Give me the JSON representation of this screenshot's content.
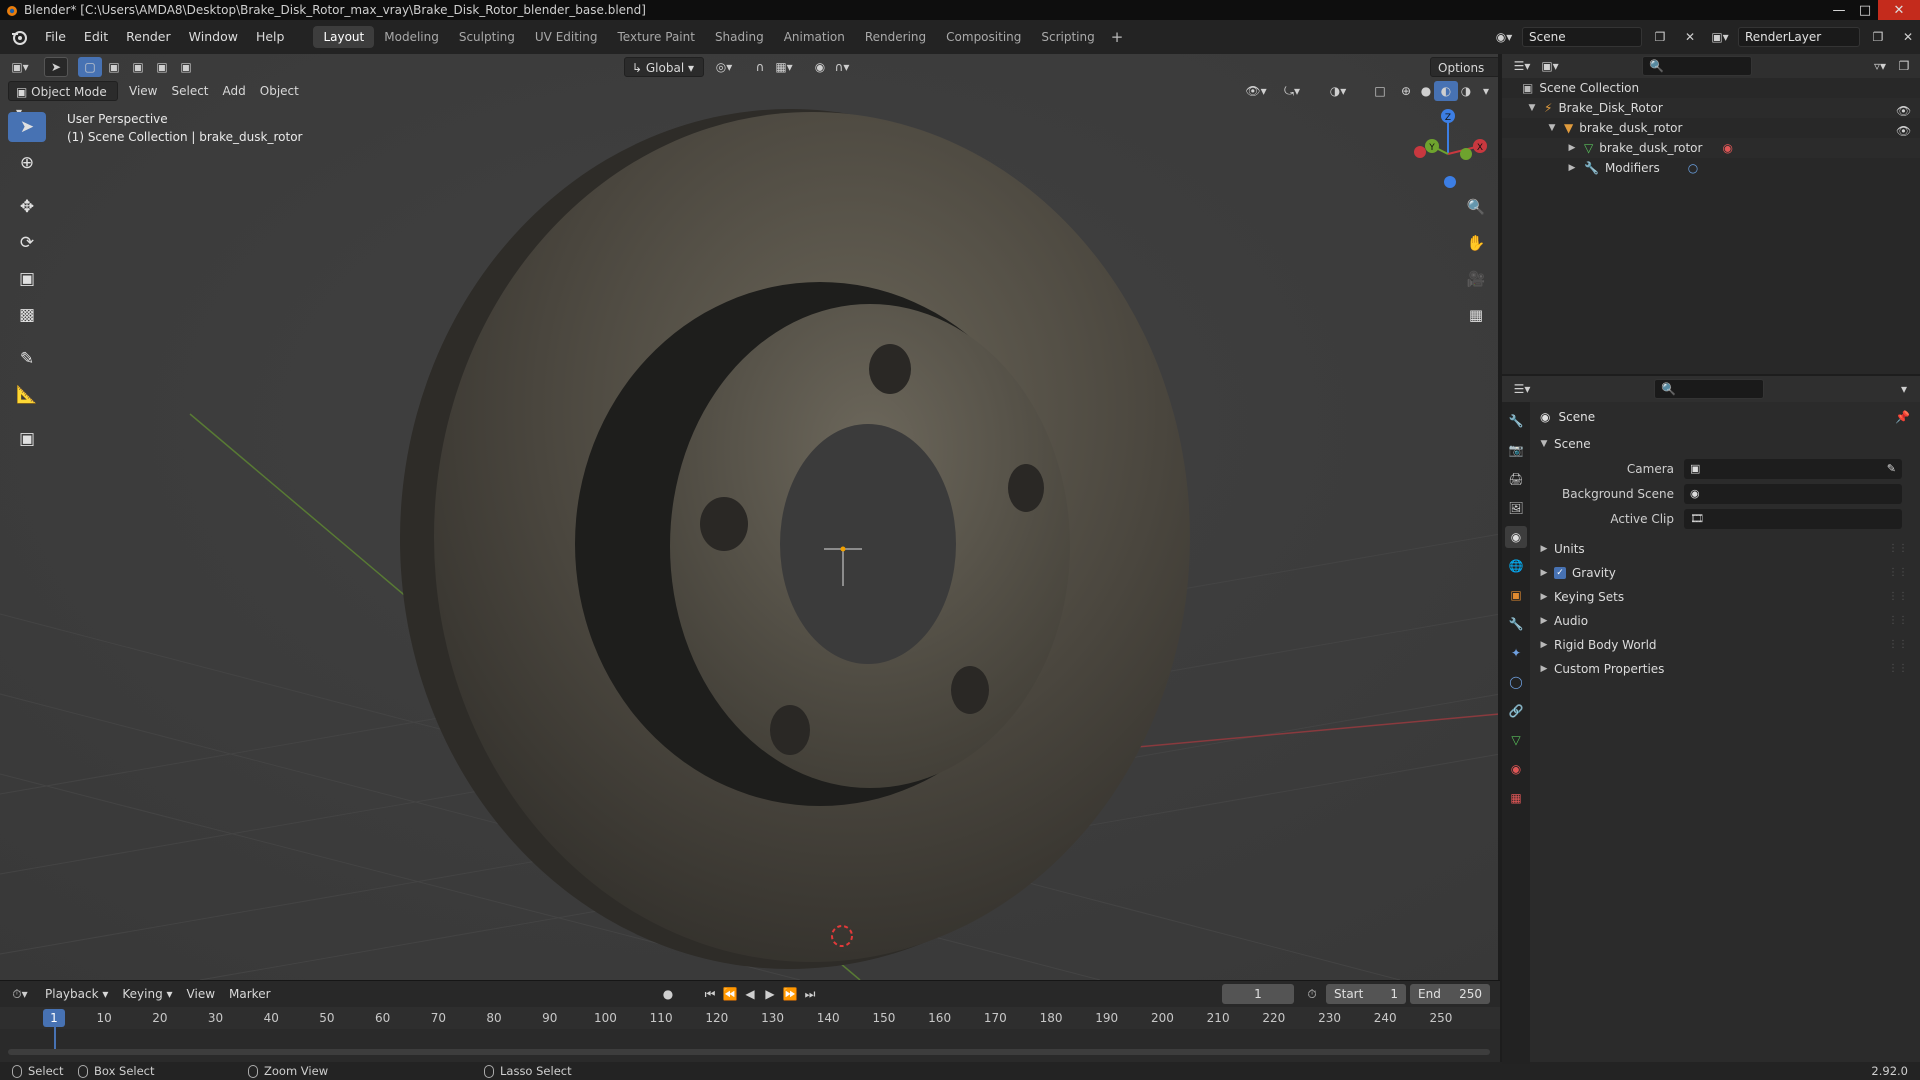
{
  "window": {
    "title": "Blender* [C:\\Users\\AMDA8\\Desktop\\Brake_Disk_Rotor_max_vray\\Brake_Disk_Rotor_blender_base.blend]"
  },
  "menu": [
    "File",
    "Edit",
    "Render",
    "Window",
    "Help"
  ],
  "workspaces": [
    "Layout",
    "Modeling",
    "Sculpting",
    "UV Editing",
    "Texture Paint",
    "Shading",
    "Animation",
    "Rendering",
    "Compositing",
    "Scripting"
  ],
  "active_workspace": "Layout",
  "scene_field": "Scene",
  "renderlayer_field": "RenderLayer",
  "viewport": {
    "mode": "Object Mode",
    "menus": [
      "View",
      "Select",
      "Add",
      "Object"
    ],
    "transform_orientation": "Global",
    "options_label": "Options",
    "info_line1": "User Perspective",
    "info_line2": "(1) Scene Collection | brake_dusk_rotor",
    "gizmo_axes": [
      "X",
      "Y",
      "Z"
    ]
  },
  "outliner": {
    "root": "Scene Collection",
    "items": [
      {
        "label": "Brake_Disk_Rotor",
        "level": 1
      },
      {
        "label": "brake_dusk_rotor",
        "level": 2
      },
      {
        "label": "brake_dusk_rotor",
        "level": 3
      },
      {
        "label": "Modifiers",
        "level": 3
      }
    ]
  },
  "properties": {
    "context_title": "Scene",
    "panel_scene": "Scene",
    "fields": [
      {
        "label": "Camera",
        "value": ""
      },
      {
        "label": "Background Scene",
        "value": ""
      },
      {
        "label": "Active Clip",
        "value": ""
      }
    ],
    "collapsed_panels": [
      "Units",
      "Gravity",
      "Keying Sets",
      "Audio",
      "Rigid Body World",
      "Custom Properties"
    ],
    "gravity_checked": true
  },
  "timeline": {
    "menus": [
      "Playback",
      "Keying",
      "View",
      "Marker"
    ],
    "current_frame": "1",
    "start_label": "Start",
    "start_value": "1",
    "end_label": "End",
    "end_value": "250",
    "ticks": [
      "10",
      "20",
      "30",
      "40",
      "50",
      "60",
      "70",
      "80",
      "90",
      "100",
      "110",
      "120",
      "130",
      "140",
      "150",
      "160",
      "170",
      "180",
      "190",
      "200",
      "210",
      "220",
      "230",
      "240",
      "250"
    ],
    "playhead_frame": "1"
  },
  "statusbar": {
    "select": "Select",
    "box_select": "Box Select",
    "zoom_view": "Zoom View",
    "lasso_select": "Lasso Select",
    "version": "2.92.0"
  },
  "colors": {
    "accent": "#4772b3",
    "x_axis": "#c8383f",
    "y_axis": "#6ea32e",
    "z_axis": "#3c7ee4"
  }
}
